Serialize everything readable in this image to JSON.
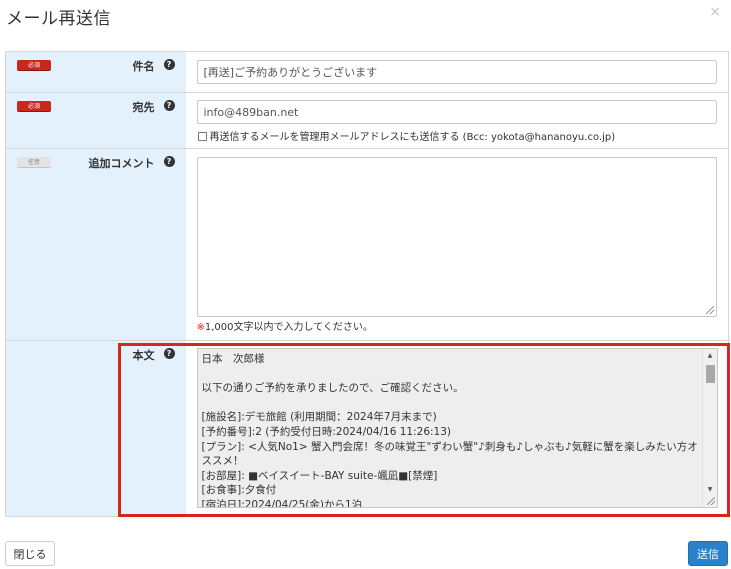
{
  "dialog": {
    "title": "メール再送信",
    "close_glyph": "×"
  },
  "form": {
    "subject": {
      "badge": "必須",
      "label": "件名",
      "value": "[再送]ご予約ありがとうございます"
    },
    "recipient": {
      "badge": "必須",
      "label": "宛先",
      "value": "info@489ban.net",
      "checkbox_label": "再送信するメールを管理用メールアドレスにも送信する (Bcc: yokota@hananoyu.co.jp)",
      "checkbox_checked": false
    },
    "comment": {
      "badge": "任意",
      "label": "追加コメント",
      "value": "",
      "hint_mark": "※",
      "hint": "1,000文字以内で入力してください。"
    },
    "body": {
      "label": "本文",
      "value": "日本　次郎様\n\n以下の通りご予約を承りましたので、ご確認ください。\n\n[施設名]:デモ旅館 (利用期間：2024年7月末まで)\n[予約番号]:2 (予約受付日時:2024/04/16 11:26:13)\n[プラン]: <人気No1> 蟹入門会席！冬の味覚王\"ずわい蟹\"♪刺身も♪しゃぶも♪気軽に蟹を楽しみたい方オススメ！\n[お部屋]: ■ベイスイート-BAY suite-颯凪■[禁煙]\n[お食事]:夕食付\n[宿泊日]:2024/04/25(金)から1泊"
    }
  },
  "help_glyph": "?",
  "buttons": {
    "close_label": "閉じる",
    "send_label": "送信"
  },
  "colors": {
    "label_bg": "#e2f1fc",
    "required_badge": "#c9261c",
    "highlight_border": "#d9261c",
    "primary_button": "#2b82cb"
  }
}
